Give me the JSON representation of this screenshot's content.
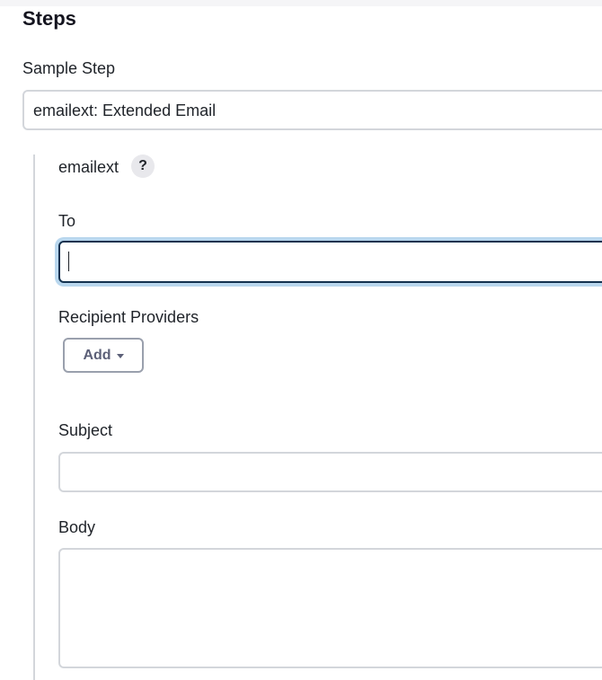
{
  "steps": {
    "title": "Steps"
  },
  "sample_step": {
    "label": "Sample Step",
    "selected_value": "emailext: Extended Email"
  },
  "emailext": {
    "title": "emailext",
    "help_icon_text": "?",
    "to": {
      "label": "To",
      "value": ""
    },
    "recipient_providers": {
      "label": "Recipient Providers",
      "add_label": "Add"
    },
    "subject": {
      "label": "Subject",
      "value": ""
    },
    "body": {
      "label": "Body",
      "value": ""
    }
  },
  "colors": {
    "focus_border": "#14324f",
    "focus_ring": "#b9d7ee",
    "input_border": "#d3d6db",
    "button_text": "#5c6078"
  },
  "icons": {
    "help": "question-mark",
    "dropdown": "chevron-down"
  }
}
